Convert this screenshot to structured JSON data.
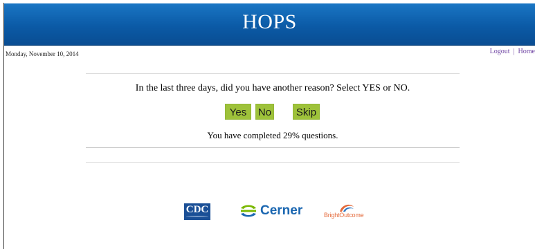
{
  "header": {
    "title": "HOPS"
  },
  "date": "Monday, November 10, 2014",
  "top_links": {
    "logout": "Logout",
    "separator": "|",
    "home": "Home"
  },
  "question": {
    "text": "In the last three days, did you have another reason? Select YES or NO."
  },
  "buttons": {
    "yes": "Yes",
    "no": "No",
    "skip": "Skip"
  },
  "progress": {
    "text": "You have completed 29% questions.",
    "percent": 29
  },
  "logos": {
    "cdc": "CDC",
    "cerner": "Cerner",
    "brightoutcome": "BrightOutcome"
  },
  "colors": {
    "header_blue": "#0b5aa6",
    "button_green": "#9ec23a",
    "link_purple": "#6b3fa0",
    "cerner_blue": "#1b67b1",
    "cerner_green": "#7ab800",
    "bright_orange": "#e46a3b"
  }
}
